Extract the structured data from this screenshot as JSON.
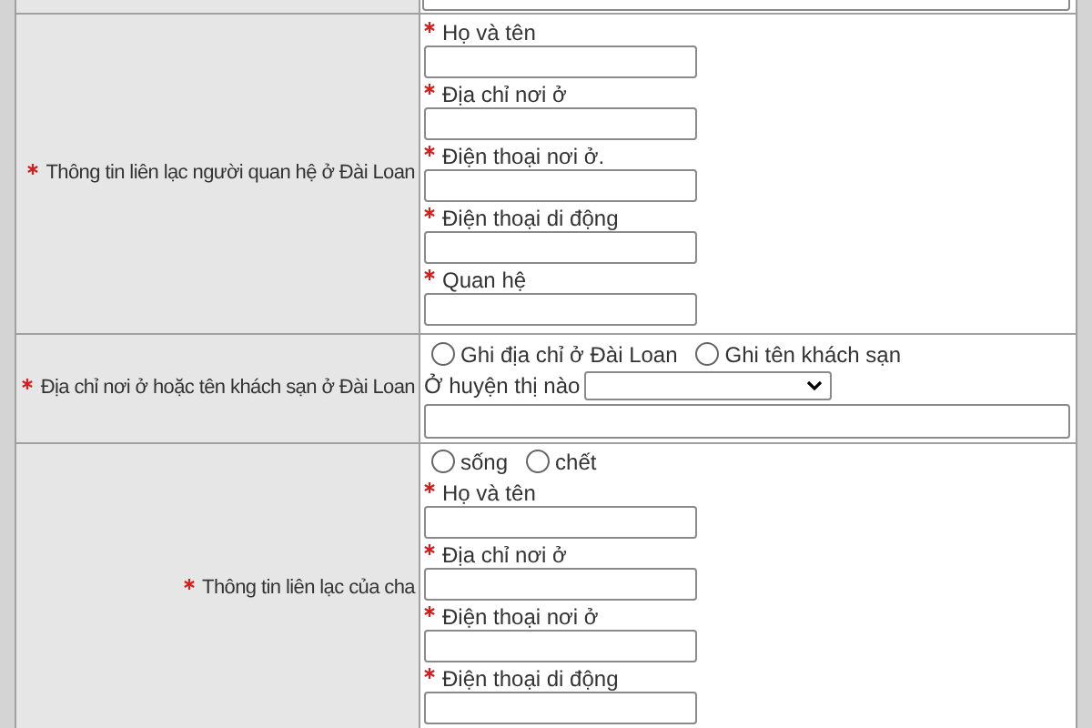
{
  "rows": [
    {
      "kind": "top"
    },
    {
      "kind": "fields",
      "label": "Thông tin liên lạc người quan hệ ở Đài Loan",
      "required": true,
      "fields": [
        {
          "label": "Họ và tên",
          "required": true
        },
        {
          "label": "Địa chỉ nơi ở",
          "required": true
        },
        {
          "label": "Điện thoại nơi ở.",
          "required": true
        },
        {
          "label": "Điện thoại di động",
          "required": true
        },
        {
          "label": "Quan hệ",
          "required": true
        }
      ]
    },
    {
      "kind": "address",
      "label": "Địa chỉ nơi ở hoặc tên khách sạn ở Đài Loan",
      "required": true,
      "radios": [
        {
          "label": "Ghi địa chỉ ở Đài Loan",
          "selected": false
        },
        {
          "label": "Ghi tên khách sạn",
          "selected": false
        }
      ],
      "select_label": "Ở huyện thị nào"
    },
    {
      "kind": "fields",
      "label": "Thông tin liên lạc của cha",
      "required": true,
      "radios": [
        {
          "label": "sống",
          "selected": false
        },
        {
          "label": "chết",
          "selected": false
        }
      ],
      "fields": [
        {
          "label": "Họ và tên",
          "required": true
        },
        {
          "label": "Địa chỉ nơi ở",
          "required": true
        },
        {
          "label": "Điện thoại nơi ở",
          "required": true
        },
        {
          "label": "Điện thoại di động",
          "required": true
        }
      ]
    }
  ]
}
